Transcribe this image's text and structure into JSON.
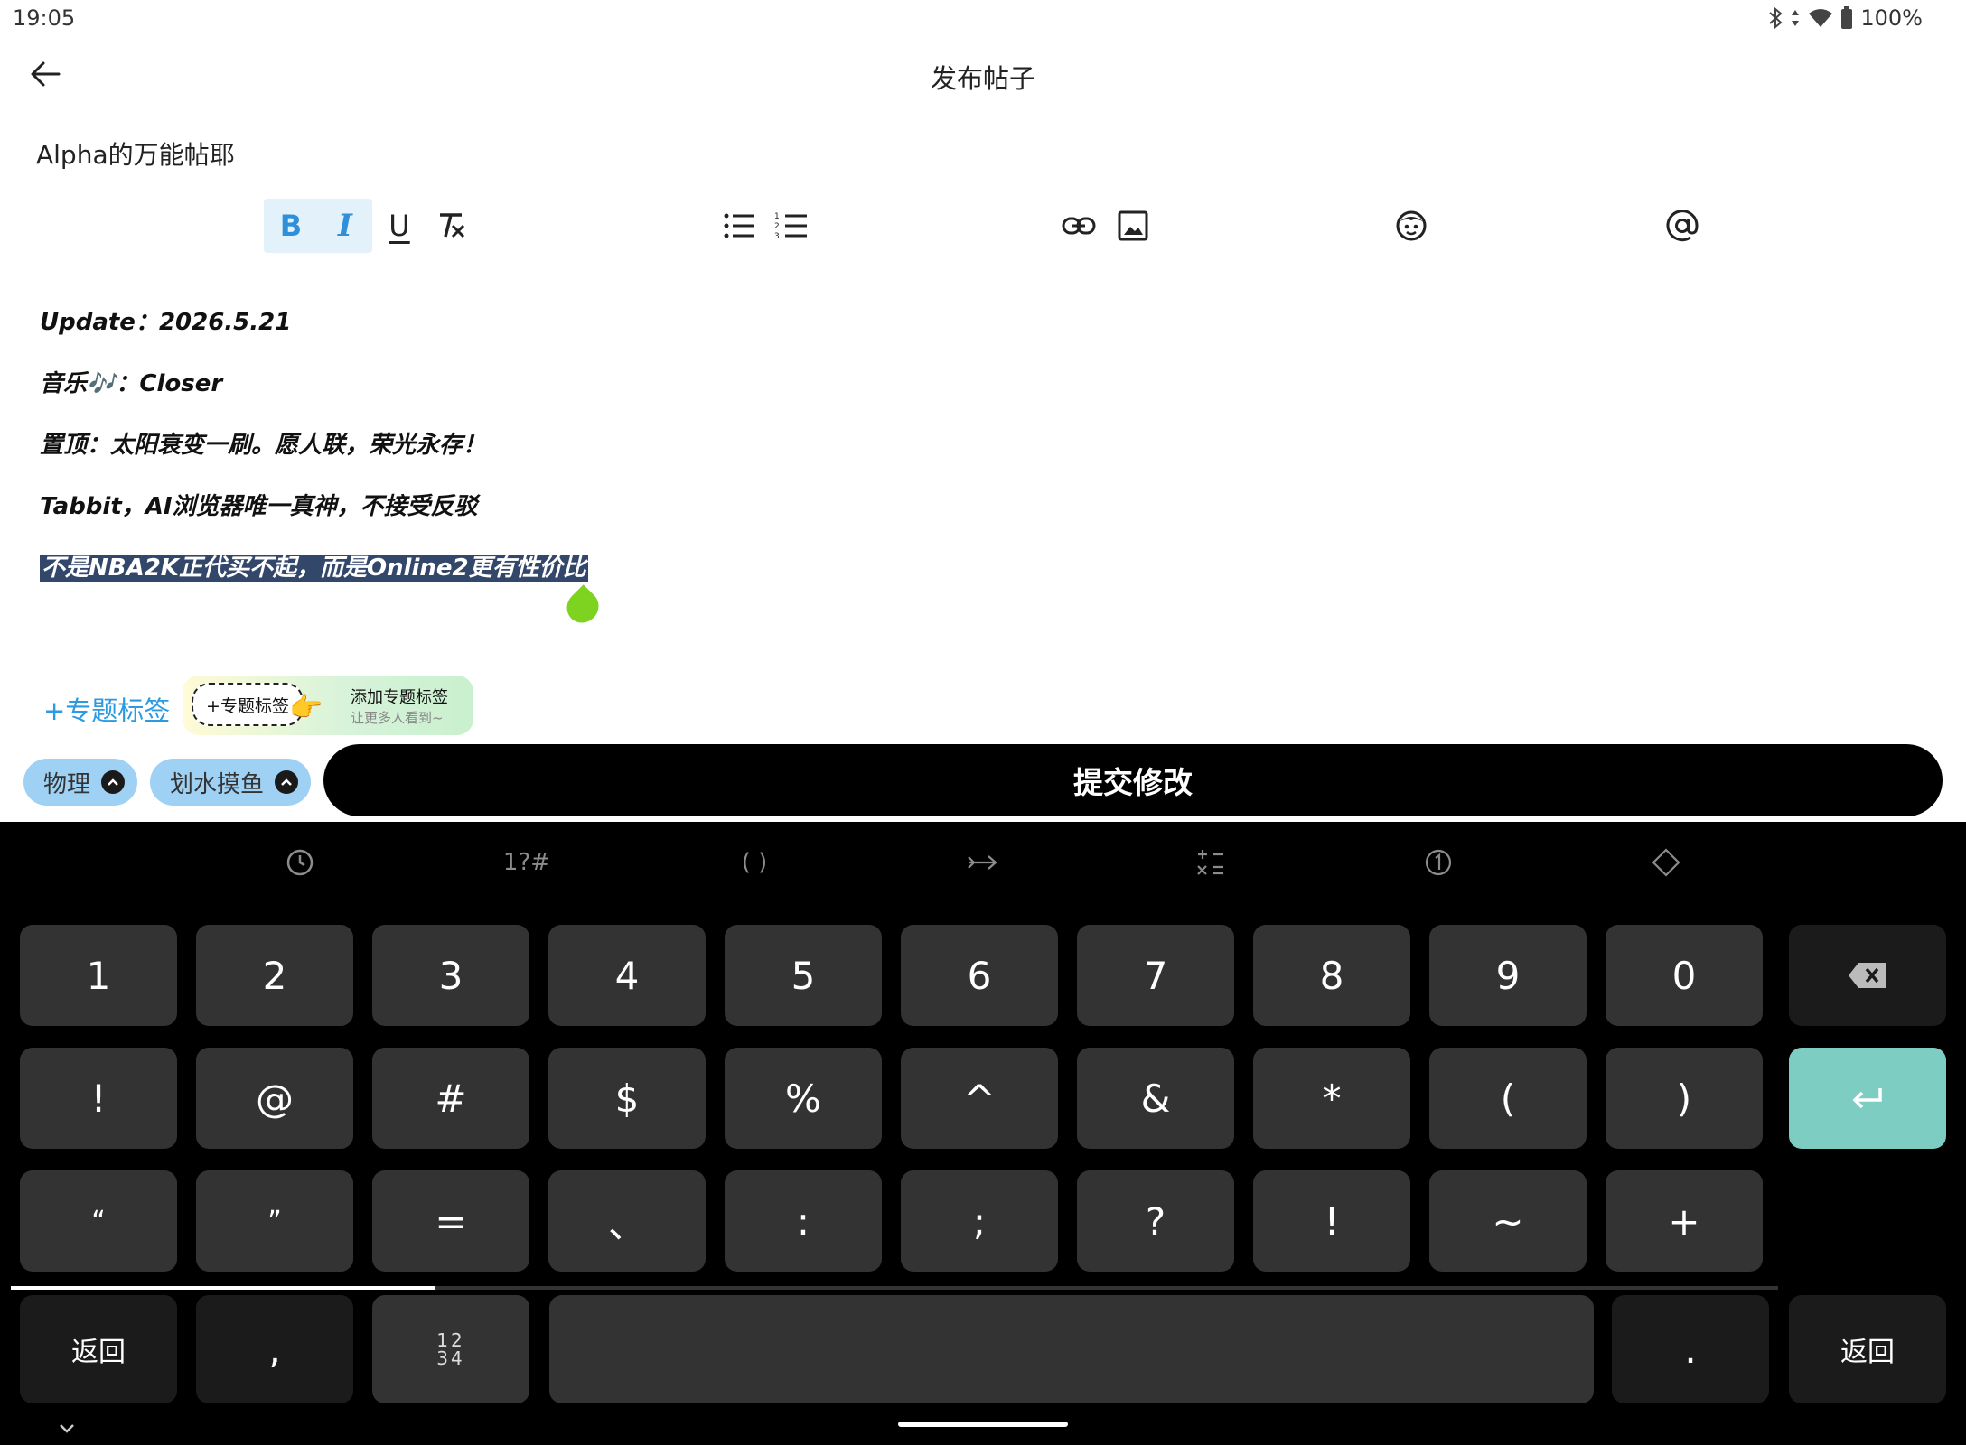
{
  "status_bar": {
    "time": "19:05",
    "battery": "100%"
  },
  "header": {
    "title": "发布帖子"
  },
  "post": {
    "title": "Alpha的万能帖耶",
    "lines": [
      "Update：2026.5.21",
      "音乐🎶：Closer",
      "置顶：太阳衰变一刷。愿人联，荣光永存！",
      "Tabbit，AI浏览器唯一真神，不接受反驳",
      "不是NBA2K正代买不起，而是Online2更有性价比"
    ]
  },
  "toolbar": {
    "bold": "B",
    "italic": "I",
    "underline": "U"
  },
  "tags": {
    "add_topic": "+专题标签",
    "promo_chip": "+专题标签",
    "promo_title": "添加专题标签",
    "promo_sub": "让更多人看到~",
    "categories": [
      "物理",
      "划水摸鱼"
    ]
  },
  "submit_label": "提交修改",
  "keyboard": {
    "top_row": {
      "symbols": "1?#",
      "brackets": "( )"
    },
    "row1": [
      "1",
      "2",
      "3",
      "4",
      "5",
      "6",
      "7",
      "8",
      "9",
      "0"
    ],
    "row2": [
      "!",
      "@",
      "#",
      "$",
      "%",
      "^",
      "&",
      "*",
      "(",
      ")"
    ],
    "row3": [
      "“",
      "”",
      "=",
      "、",
      ":",
      ";",
      "?",
      "!",
      "~",
      "+"
    ],
    "bottom": {
      "back_left": "返回",
      "comma": ",",
      "num_top": "12",
      "num_bottom": "34",
      "period": ".",
      "back_right": "返回"
    },
    "page_scroll_progress": 0.24
  },
  "colors": {
    "accent": "#2f8fd8",
    "selection": "#33476b",
    "enter_key": "#7ecdc3",
    "category_chip": "#9fd1f5"
  }
}
